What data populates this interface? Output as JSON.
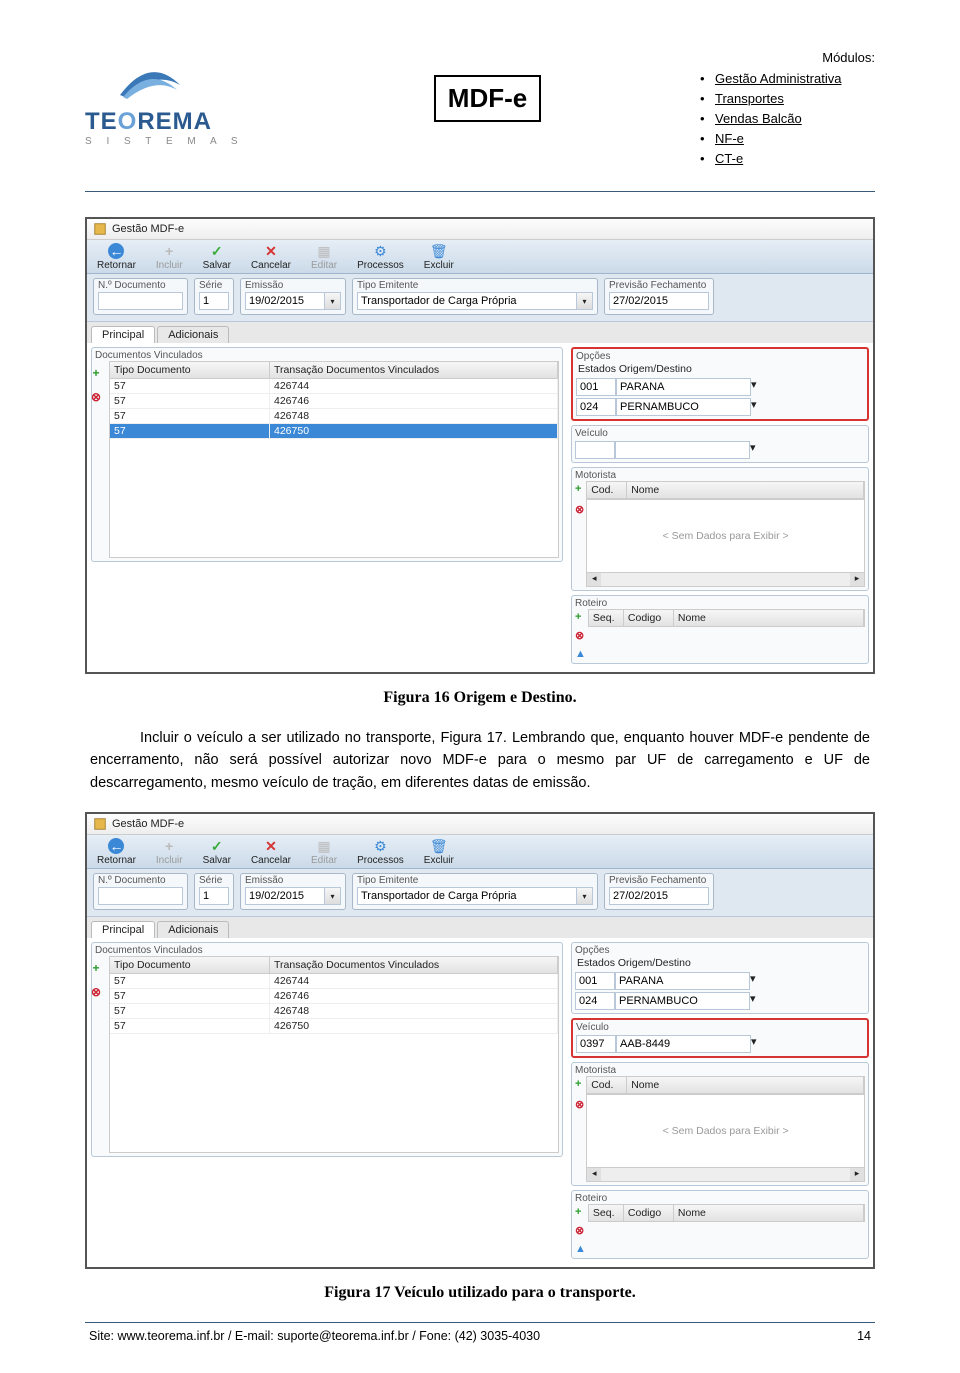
{
  "header": {
    "logo_main": "TEOREMA",
    "logo_sub": "S I S T E M A S",
    "mdfe_label": "MDF-e",
    "modules_title": "Módulos:",
    "modules": [
      "Gestão Administrativa",
      "Transportes",
      "Vendas Balcão",
      "NF-e",
      "CT-e"
    ]
  },
  "screenshot1": {
    "window_title": "Gestão MDF-e",
    "toolbar": {
      "retornar": "Retornar",
      "incluir": "Incluir",
      "salvar": "Salvar",
      "cancelar": "Cancelar",
      "editar": "Editar",
      "processos": "Processos",
      "excluir": "Excluir"
    },
    "fields": {
      "ndoc_label": "N.º Documento",
      "ndoc_value": "",
      "serie_label": "Série",
      "serie_value": "1",
      "emissao_label": "Emissão",
      "emissao_value": "19/02/2015",
      "tipoemit_label": "Tipo Emitente",
      "tipoemit_value": "Transportador de Carga Própria",
      "prev_label": "Previsão Fechamento",
      "prev_value": "27/02/2015"
    },
    "tabs": {
      "principal": "Principal",
      "adicionais": "Adicionais"
    },
    "docs_panel_title": "Documentos Vinculados",
    "docs_headers": {
      "tipo": "Tipo Documento",
      "trans": "Transação Documentos Vinculados"
    },
    "docs_rows": [
      {
        "tipo": "57",
        "trans": "426744"
      },
      {
        "tipo": "57",
        "trans": "426746"
      },
      {
        "tipo": "57",
        "trans": "426748"
      },
      {
        "tipo": "57",
        "trans": "426750"
      }
    ],
    "docs_selected_index": 3,
    "opcoes_title": "Opções",
    "od_title": "Estados Origem/Destino",
    "od_origem_code": "001",
    "od_origem_name": "PARANA",
    "od_dest_code": "024",
    "od_dest_name": "PERNAMBUCO",
    "veiculo_title": "Veículo",
    "veiculo_code": "",
    "veiculo_name": "",
    "motorista_title": "Motorista",
    "motorista_headers": {
      "cod": "Cod.",
      "nome": "Nome"
    },
    "nodata_text": "< Sem Dados para Exibir >",
    "roteiro_title": "Roteiro",
    "roteiro_headers": {
      "seq": "Seq.",
      "codigo": "Codigo",
      "nome": "Nome"
    },
    "highlight_panel": "opcoes"
  },
  "screenshot2": {
    "veiculo_code": "0397",
    "veiculo_name": "AAB-8449",
    "docs_selected_index": -1,
    "highlight_panel": "veiculo"
  },
  "caption1": "Figura 16 Origem e Destino.",
  "para1": "Incluir o veículo a ser utilizado no transporte, Figura 17. Lembrando que, enquanto houver MDF-e pendente de encerramento, não será possível autorizar novo MDF-e para o mesmo par UF de carregamento e UF de descarregamento, mesmo veículo de tração, em diferentes datas de emissão.",
  "caption2": "Figura 17 Veículo utilizado para o transporte.",
  "footer": {
    "left": "Site: www.teorema.inf.br / E-mail: suporte@teorema.inf.br / Fone: (42) 3035-4030",
    "right": "14"
  }
}
